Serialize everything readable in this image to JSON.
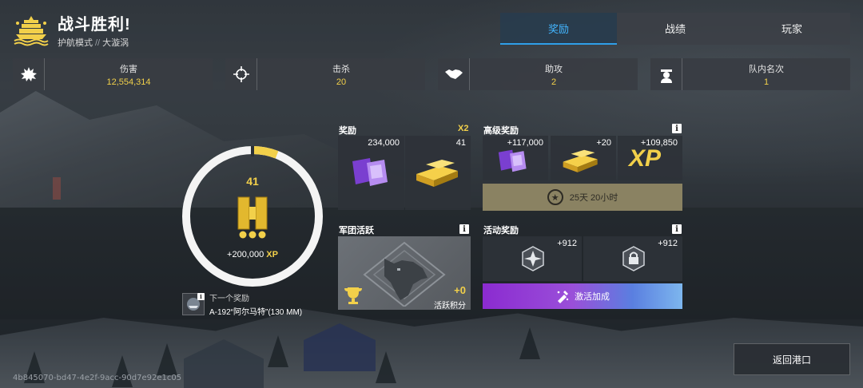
{
  "header": {
    "title": "战斗胜利!",
    "mode": "护航模式",
    "separator": "//",
    "map": "大漩涡"
  },
  "tabs": [
    {
      "label": "奖励",
      "active": true
    },
    {
      "label": "战绩",
      "active": false
    },
    {
      "label": "玩家",
      "active": false
    }
  ],
  "stats": [
    {
      "icon": "explosion-icon",
      "label": "伤害",
      "value": "12,554,314"
    },
    {
      "icon": "crosshair-icon",
      "label": "击杀",
      "value": "20"
    },
    {
      "icon": "handshake-icon",
      "label": "助攻",
      "value": "2"
    },
    {
      "icon": "sailor-icon",
      "label": "队内名次",
      "value": "1"
    }
  ],
  "level_ring": {
    "level": "41",
    "xp": "+200,000",
    "xp_unit": "XP",
    "progress": 0.06
  },
  "next_reward": {
    "label": "下一个奖励",
    "name": "A-192“阿尔马特”(130 MM)"
  },
  "rewards": {
    "title": "奖励",
    "multiplier": "X2",
    "items": [
      {
        "icon": "blueprint-icon",
        "count": "234,000"
      },
      {
        "icon": "gold-bars-icon",
        "count": "41"
      }
    ]
  },
  "premium_rewards": {
    "title": "高级奖励",
    "items": [
      {
        "icon": "blueprint-icon",
        "count": "+117,000"
      },
      {
        "icon": "gold-bars-icon",
        "count": "+20"
      },
      {
        "icon": "xp-icon",
        "count": "+109,850",
        "text": "XP"
      }
    ],
    "timer": "25天 20小时"
  },
  "legion_activity": {
    "title": "军团活跃",
    "points": "+0",
    "points_label": "活跃积分"
  },
  "event_rewards": {
    "title": "活动奖励",
    "items": [
      {
        "icon": "compass-badge-icon",
        "count": "+912"
      },
      {
        "icon": "locked-badge-icon",
        "count": "+912"
      }
    ],
    "activate_label": "激活加成"
  },
  "actions": {
    "return_label": "返回港口"
  },
  "session_id": "4b845070-bd47-4e2f-9acc-90d7e92e1c05",
  "colors": {
    "accent_blue": "#2f9fe8",
    "gold": "#f2d04a",
    "purple": "#8b2bd0"
  }
}
